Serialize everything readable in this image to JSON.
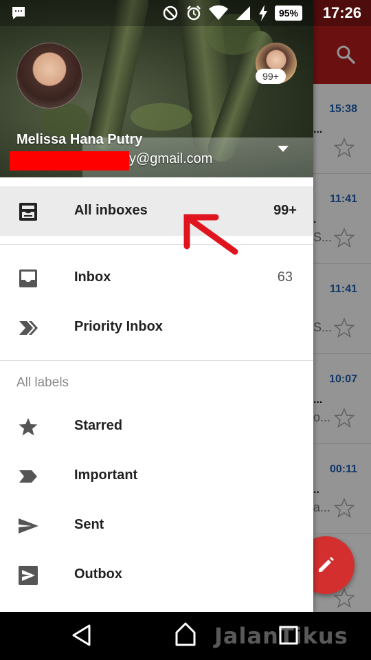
{
  "status_bar": {
    "time": "17:26",
    "battery": "95%",
    "icons": [
      "notification-icon",
      "do-not-disturb-icon",
      "alarm-icon",
      "wifi-icon",
      "signal-icon",
      "charging-icon"
    ]
  },
  "background_list": {
    "times": [
      "15:38",
      "11:41",
      "11:41",
      "10:07",
      "00:11"
    ],
    "fragments": [
      "...",
      "S...",
      "S...",
      "o...",
      "a..."
    ],
    "colors": {
      "toolbar": "#b71c1c",
      "time_text": "#1e5fb4",
      "fab": "#d32f2f"
    }
  },
  "account": {
    "name": "Melissa Hana Putry",
    "email_suffix": "y@gmail.com",
    "secondary_badge": "99+"
  },
  "nav": {
    "all_inboxes": {
      "label": "All inboxes",
      "count": "99+",
      "selected": true
    },
    "inbox": {
      "label": "Inbox",
      "count": "63"
    },
    "priority_inbox": {
      "label": "Priority Inbox"
    },
    "section_label": "All labels",
    "starred": {
      "label": "Starred"
    },
    "important": {
      "label": "Important"
    },
    "sent": {
      "label": "Sent"
    },
    "outbox": {
      "label": "Outbox"
    }
  },
  "watermark": "JalanTikus",
  "annotation": {
    "color": "#e0141e"
  }
}
